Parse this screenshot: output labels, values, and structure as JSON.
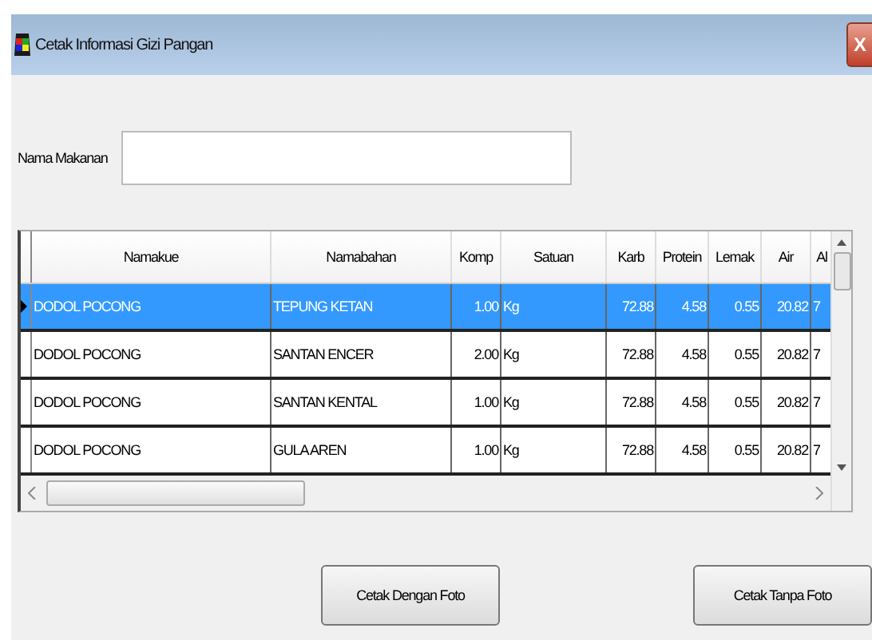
{
  "window": {
    "title": "Cetak Informasi Gizi Pangan",
    "close": "X"
  },
  "form": {
    "label": "Nama Makanan"
  },
  "table": {
    "columns": [
      "Namakue",
      "Namabahan",
      "Komp",
      "Satuan",
      "Karb",
      "Protein",
      "Lemak",
      "Air",
      "Al"
    ],
    "rows": [
      {
        "selected": true,
        "cells": [
          "DODOL POCONG",
          "TEPUNG KETAN",
          "1.00",
          "Kg",
          "72.88",
          "4.58",
          "0.55",
          "20.82",
          "7"
        ]
      },
      {
        "selected": false,
        "cells": [
          "DODOL POCONG",
          "SANTAN ENCER",
          "2.00",
          "Kg",
          "72.88",
          "4.58",
          "0.55",
          "20.82",
          "7"
        ]
      },
      {
        "selected": false,
        "cells": [
          "DODOL POCONG",
          "SANTAN KENTAL",
          "1.00",
          "Kg",
          "72.88",
          "4.58",
          "0.55",
          "20.82",
          "7"
        ]
      },
      {
        "selected": false,
        "cells": [
          "DODOL POCONG",
          "GULA AREN",
          "1.00",
          "Kg",
          "72.88",
          "4.58",
          "0.55",
          "20.82",
          "7"
        ]
      }
    ]
  },
  "buttons": [
    "Cetak Dengan Foto",
    "Cetak Tanpa Foto"
  ]
}
